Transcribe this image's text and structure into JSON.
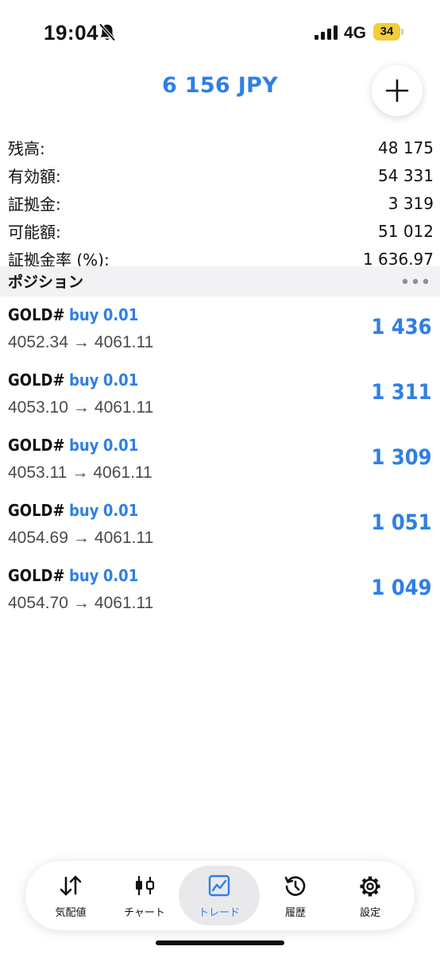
{
  "status_bar": {
    "time": "19:04",
    "network": "4G",
    "battery": "34"
  },
  "header": {
    "total": "6 156 JPY"
  },
  "summary": [
    {
      "label": "残高:",
      "value": "48 175"
    },
    {
      "label": "有効額:",
      "value": "54 331"
    },
    {
      "label": "証拠金:",
      "value": "3 319"
    },
    {
      "label": "可能額:",
      "value": "51 012"
    },
    {
      "label": "証拠金率 (%):",
      "value": "1 636.97"
    }
  ],
  "positions_section": {
    "title": "ポジション"
  },
  "positions": [
    {
      "symbol": "GOLD#",
      "side": "buy",
      "volume": "0.01",
      "open_price": "4052.34",
      "arrow": "→",
      "current_price": "4061.11",
      "profit": "1 436"
    },
    {
      "symbol": "GOLD#",
      "side": "buy",
      "volume": "0.01",
      "open_price": "4053.10",
      "arrow": "→",
      "current_price": "4061.11",
      "profit": "1 311"
    },
    {
      "symbol": "GOLD#",
      "side": "buy",
      "volume": "0.01",
      "open_price": "4053.11",
      "arrow": "→",
      "current_price": "4061.11",
      "profit": "1 309"
    },
    {
      "symbol": "GOLD#",
      "side": "buy",
      "volume": "0.01",
      "open_price": "4054.69",
      "arrow": "→",
      "current_price": "4061.11",
      "profit": "1 051"
    },
    {
      "symbol": "GOLD#",
      "side": "buy",
      "volume": "0.01",
      "open_price": "4054.70",
      "arrow": "→",
      "current_price": "4061.11",
      "profit": "1 049"
    }
  ],
  "tab_bar": {
    "active": "trade",
    "tabs": [
      {
        "id": "quotes",
        "label": "気配値",
        "icon": "arrows-up-down-icon"
      },
      {
        "id": "chart",
        "label": "チャート",
        "icon": "candlestick-icon"
      },
      {
        "id": "trade",
        "label": "トレード",
        "icon": "trade-chart-icon"
      },
      {
        "id": "history",
        "label": "履歴",
        "icon": "history-icon"
      },
      {
        "id": "settings",
        "label": "設定",
        "icon": "gear-icon"
      }
    ]
  },
  "colors": {
    "accent": "#2f7fe3",
    "section_background": "#f2f2f4",
    "battery": "#f1cd3b"
  }
}
